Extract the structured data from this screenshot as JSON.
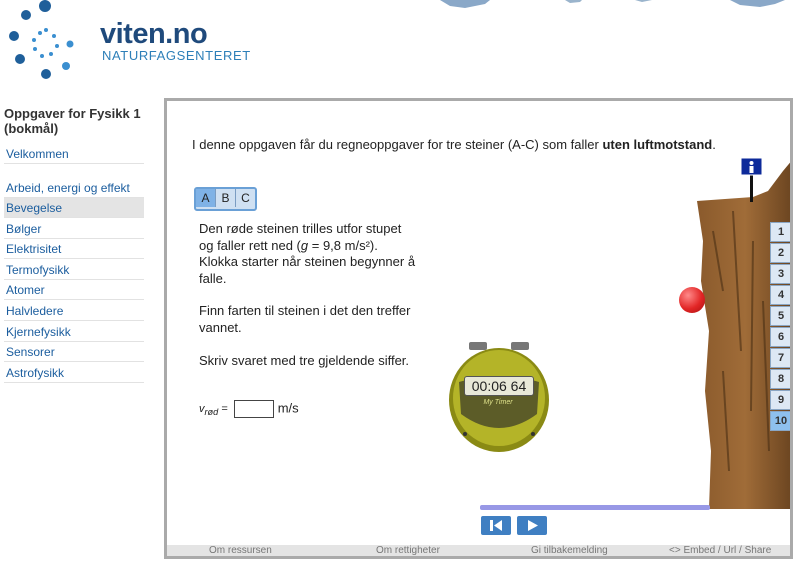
{
  "header": {
    "logo_main": "viten.no",
    "logo_sub": "NATURFAGSENTERET"
  },
  "sidebar": {
    "title": "Oppgaver for Fysikk 1 (bokmål)",
    "items": [
      {
        "label": "Velkommen"
      },
      {
        "label": "Arbeid, energi og effekt"
      },
      {
        "label": "Bevegelse"
      },
      {
        "label": "Bølger"
      },
      {
        "label": "Elektrisitet"
      },
      {
        "label": "Termofysikk"
      },
      {
        "label": "Atomer"
      },
      {
        "label": "Halvledere"
      },
      {
        "label": "Kjernefysikk"
      },
      {
        "label": "Sensorer"
      },
      {
        "label": "Astrofysikk"
      }
    ],
    "active": "Bevegelse"
  },
  "task": {
    "intro_prefix": "I denne oppgaven får du regneoppgaver for tre steiner (A-C) som faller ",
    "intro_bold": "uten luftmotstand",
    "intro_suffix": ".",
    "tabs": [
      "A",
      "B",
      "C"
    ],
    "active_tab": "A",
    "para1_a": "Den røde steinen trilles utfor stupet og faller rett ned (",
    "para1_g": "g",
    "para1_b": " = 9,8 m/s²). Klokka starter når steinen begynner å falle.",
    "para2": "Finn farten til steinen i det den treffer vannet.",
    "para3": "Skriv svaret med tre gjeldende siffer.",
    "answer_label_var": "v",
    "answer_label_sub": "rød",
    "answer_label_eq": " =",
    "answer_value": "",
    "answer_unit": "m/s"
  },
  "stopwatch": {
    "time": "00:06 64",
    "brand": "My Timer"
  },
  "steps": [
    "1",
    "2",
    "3",
    "4",
    "5",
    "6",
    "7",
    "8",
    "9",
    "10"
  ],
  "active_step": "10",
  "footer": {
    "resources": "Om ressursen",
    "rights": "Om rettigheter",
    "feedback": "Gi tilbakemelding",
    "embed": "<> Embed / Url / Share"
  },
  "colors": {
    "brand_dark": "#1f4a7c",
    "brand_light": "#2d7fb8",
    "link": "#1b5d9e",
    "control": "#3f7fc2",
    "ball": "#e22626",
    "stopwatch": "#a8a81a"
  }
}
